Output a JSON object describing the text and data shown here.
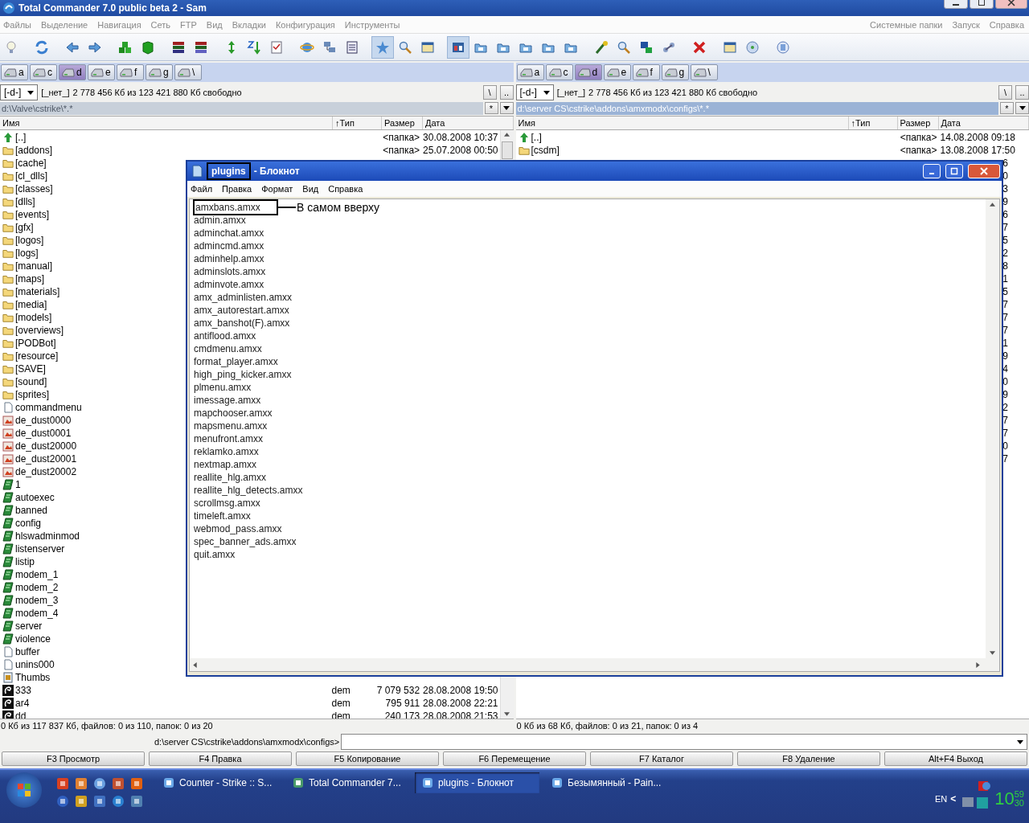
{
  "window": {
    "title": "Total Commander 7.0 public beta 2 - Sam"
  },
  "menu_left": [
    "Файлы",
    "Выделение",
    "Навигация",
    "Сеть",
    "FTP",
    "Вид",
    "Вкладки",
    "Конфигурация",
    "Инструменты"
  ],
  "menu_right": [
    "Системные папки",
    "Запуск",
    "Справка"
  ],
  "toolbar": [
    {
      "pressed": false
    },
    {
      "pressed": false
    },
    {
      "pressed": false
    },
    {
      "pressed": false
    },
    {
      "pressed": false
    },
    {
      "pressed": false
    },
    {
      "pressed": false
    },
    {
      "pressed": false
    },
    {
      "pressed": false
    },
    {
      "pressed": false
    },
    {
      "pressed": false
    },
    {
      "pressed": false
    },
    {
      "pressed": false
    },
    {
      "pressed": false
    },
    {
      "pressed": true
    },
    {
      "pressed": false
    },
    {
      "pressed": false
    },
    {
      "pressed": true
    },
    {
      "pressed": false
    },
    {
      "pressed": false
    },
    {
      "pressed": false
    },
    {
      "pressed": false
    },
    {
      "pressed": false
    },
    {
      "pressed": false
    },
    {
      "pressed": false
    },
    {
      "pressed": false
    },
    {
      "pressed": false
    },
    {
      "pressed": false
    },
    {
      "pressed": false
    },
    {
      "pressed": false
    },
    {
      "pressed": false
    }
  ],
  "panels": [
    {
      "drives": [
        {
          "label": "a",
          "selected": false
        },
        {
          "label": "c",
          "selected": false
        },
        {
          "label": "d",
          "selected": true
        },
        {
          "label": "e",
          "selected": false
        },
        {
          "label": "f",
          "selected": false
        },
        {
          "label": "g",
          "selected": false
        },
        {
          "label": "\\",
          "selected": false
        }
      ],
      "drive_select": "[-d-]",
      "volume": "[_нет_]",
      "free_space": "2 778 456 Кб из 123 421 880 Кб свободно",
      "root_button": "\\",
      "up_button": "..",
      "path": "d:\\Valve\\cstrike\\*.*",
      "active": false,
      "history_button": "*",
      "columns": [
        "Имя",
        "↑Тип",
        "Размер",
        "Дата"
      ],
      "scrollbar": true,
      "rows": [
        {
          "kind": "up",
          "name": "[..]",
          "type": "",
          "size": "<папка>",
          "date": "30.08.2008 10:37"
        },
        {
          "kind": "folder",
          "name": "[addons]",
          "size": "<папка>",
          "date": "25.07.2008 00:50"
        },
        {
          "kind": "folder",
          "name": "[cache]"
        },
        {
          "kind": "folder",
          "name": "[cl_dlls]"
        },
        {
          "kind": "folder",
          "name": "[classes]"
        },
        {
          "kind": "folder",
          "name": "[dlls]"
        },
        {
          "kind": "folder",
          "name": "[events]"
        },
        {
          "kind": "folder",
          "name": "[gfx]"
        },
        {
          "kind": "folder",
          "name": "[logos]"
        },
        {
          "kind": "folder",
          "name": "[logs]"
        },
        {
          "kind": "folder",
          "name": "[manual]"
        },
        {
          "kind": "folder",
          "name": "[maps]"
        },
        {
          "kind": "folder",
          "name": "[materials]"
        },
        {
          "kind": "folder",
          "name": "[media]"
        },
        {
          "kind": "folder",
          "name": "[models]"
        },
        {
          "kind": "folder",
          "name": "[overviews]"
        },
        {
          "kind": "folder",
          "name": "[PODBot]"
        },
        {
          "kind": "folder",
          "name": "[resource]"
        },
        {
          "kind": "folder",
          "name": "[SAVE]"
        },
        {
          "kind": "folder",
          "name": "[sound]"
        },
        {
          "kind": "folder",
          "name": "[sprites]"
        },
        {
          "kind": "doc",
          "name": "commandmenu"
        },
        {
          "kind": "image",
          "name": "de_dust0000"
        },
        {
          "kind": "image",
          "name": "de_dust0001"
        },
        {
          "kind": "image",
          "name": "de_dust20000"
        },
        {
          "kind": "image",
          "name": "de_dust20001"
        },
        {
          "kind": "image",
          "name": "de_dust20002"
        },
        {
          "kind": "cfg",
          "name": "1"
        },
        {
          "kind": "cfg",
          "name": "autoexec"
        },
        {
          "kind": "cfg",
          "name": "banned"
        },
        {
          "kind": "cfg",
          "name": "config"
        },
        {
          "kind": "cfg",
          "name": "hlswadminmod"
        },
        {
          "kind": "cfg",
          "name": "listenserver"
        },
        {
          "kind": "cfg",
          "name": "listip"
        },
        {
          "kind": "cfg",
          "name": "modem_1"
        },
        {
          "kind": "cfg",
          "name": "modem_2"
        },
        {
          "kind": "cfg",
          "name": "modem_3"
        },
        {
          "kind": "cfg",
          "name": "modem_4"
        },
        {
          "kind": "cfg",
          "name": "server"
        },
        {
          "kind": "cfg",
          "name": "violence"
        },
        {
          "kind": "doc",
          "name": "buffer"
        },
        {
          "kind": "doc",
          "name": "unins000"
        },
        {
          "kind": "thumbs",
          "name": "Thumbs"
        },
        {
          "kind": "demo",
          "name": "333",
          "type": "dem",
          "size": "7 079 532",
          "date": "28.08.2008 19:50"
        },
        {
          "kind": "demo",
          "name": "ar4",
          "type": "dem",
          "size": "795 911",
          "date": "28.08.2008 22:21"
        },
        {
          "kind": "demo",
          "name": "dd",
          "type": "dem",
          "size": "240 173",
          "date": "28.08.2008 21:53"
        }
      ],
      "status": "0 Кб из 117 837 Кб, файлов: 0 из 110, папок: 0 из 20"
    },
    {
      "drives": [
        {
          "label": "a",
          "selected": false
        },
        {
          "label": "c",
          "selected": false
        },
        {
          "label": "d",
          "selected": true
        },
        {
          "label": "e",
          "selected": false
        },
        {
          "label": "f",
          "selected": false
        },
        {
          "label": "g",
          "selected": false
        },
        {
          "label": "\\",
          "selected": false
        }
      ],
      "drive_select": "[-d-]",
      "volume": "[_нет_]",
      "free_space": "2 778 456 Кб из 123 421 880 Кб свободно",
      "root_button": "\\",
      "up_button": "..",
      "path": "d:\\server CS\\cstrike\\addons\\amxmodx\\configs\\*.*",
      "active": true,
      "history_button": "*",
      "columns": [
        "Имя",
        "↑Тип",
        "Размер",
        "Дата"
      ],
      "rows": [
        {
          "kind": "up",
          "name": "[..]",
          "size": "<папка>",
          "date": "14.08.2008 09:18"
        },
        {
          "kind": "folder",
          "name": "[csdm]",
          "size": "<папка>",
          "date": "13.08.2008 17:50"
        },
        {
          "kind": "hidden",
          "date": "6"
        },
        {
          "kind": "hidden",
          "date": "0"
        },
        {
          "kind": "hidden",
          "date": "3"
        },
        {
          "kind": "hidden",
          "date": "9"
        },
        {
          "kind": "hidden",
          "date": "6"
        },
        {
          "kind": "hidden",
          "date": "7"
        },
        {
          "kind": "hidden",
          "date": "5"
        },
        {
          "kind": "hidden",
          "date": "2"
        },
        {
          "kind": "hidden",
          "date": "8"
        },
        {
          "kind": "hidden",
          "date": "1"
        },
        {
          "kind": "hidden",
          "date": "5"
        },
        {
          "kind": "hidden",
          "date": "7"
        },
        {
          "kind": "hidden",
          "date": "7"
        },
        {
          "kind": "hidden",
          "date": "7"
        },
        {
          "kind": "hidden",
          "date": "1"
        },
        {
          "kind": "hidden",
          "date": "9"
        },
        {
          "kind": "hidden",
          "date": "4"
        },
        {
          "kind": "hidden",
          "date": "0"
        },
        {
          "kind": "hidden",
          "date": "9"
        },
        {
          "kind": "hidden",
          "date": "2"
        },
        {
          "kind": "hidden",
          "date": "7"
        },
        {
          "kind": "hidden",
          "date": "7"
        },
        {
          "kind": "hidden",
          "date": "0"
        },
        {
          "kind": "hidden",
          "date": "7"
        }
      ],
      "status": "0 Кб из 68 Кб, файлов: 0 из 21, папок: 0 из 4"
    }
  ],
  "command_line": {
    "prompt": "d:\\server CS\\cstrike\\addons\\amxmodx\\configs>"
  },
  "function_keys": [
    "F3 Просмотр",
    "F4 Правка",
    "F5 Копирование",
    "F6 Перемещение",
    "F7 Каталог",
    "F8 Удаление",
    "Alt+F4 Выход"
  ],
  "notepad": {
    "document": "plugins",
    "document_highlighted": true,
    "title_suffix": "- Блокнот",
    "menu": [
      "Файл",
      "Правка",
      "Формат",
      "Вид",
      "Справка"
    ],
    "lines": [
      {
        "text": "amxbans.amxx",
        "highlighted": true
      },
      {
        "text": "admin.amxx",
        "highlighted": false
      },
      {
        "text": "adminchat.amxx",
        "highlighted": false
      },
      {
        "text": "admincmd.amxx",
        "highlighted": false
      },
      {
        "text": "adminhelp.amxx",
        "highlighted": false
      },
      {
        "text": "adminslots.amxx",
        "highlighted": false
      },
      {
        "text": "adminvote.amxx",
        "highlighted": false
      },
      {
        "text": "amx_adminlisten.amxx",
        "highlighted": false
      },
      {
        "text": "amx_autorestart.amxx",
        "highlighted": false
      },
      {
        "text": "amx_banshot(F).amxx",
        "highlighted": false
      },
      {
        "text": "antiflood.amxx",
        "highlighted": false
      },
      {
        "text": "cmdmenu.amxx",
        "highlighted": false
      },
      {
        "text": "format_player.amxx",
        "highlighted": false
      },
      {
        "text": "high_ping_kicker.amxx",
        "highlighted": false
      },
      {
        "text": "plmenu.amxx",
        "highlighted": false
      },
      {
        "text": "imessage.amxx",
        "highlighted": false
      },
      {
        "text": "mapchooser.amxx",
        "highlighted": false
      },
      {
        "text": "mapsmenu.amxx",
        "highlighted": false
      },
      {
        "text": "menufront.amxx",
        "highlighted": false
      },
      {
        "text": "reklamko.amxx",
        "highlighted": false
      },
      {
        "text": "nextmap.amxx",
        "highlighted": false
      },
      {
        "text": "reallite_hlg.amxx",
        "highlighted": false
      },
      {
        "text": "reallite_hlg_detects.amxx",
        "highlighted": false
      },
      {
        "text": "scrollmsg.amxx",
        "highlighted": false
      },
      {
        "text": "timeleft.amxx",
        "highlighted": false
      },
      {
        "text": "webmod_pass.amxx",
        "highlighted": false
      },
      {
        "text": "spec_banner_ads.amxx",
        "highlighted": false
      },
      {
        "text": "quit.amxx",
        "highlighted": false
      }
    ],
    "annotation": "В самом вверху"
  },
  "taskbar": {
    "tasks": [
      {
        "label": "Counter - Strike :: S...",
        "selected": false
      },
      {
        "label": "Total Commander 7...",
        "selected": false
      },
      {
        "label": "plugins - Блокнот",
        "selected": true
      },
      {
        "label": "Безымянный - Pain...",
        "selected": false
      }
    ],
    "language": "EN",
    "tray_toggle": "<",
    "clock": {
      "hours": "10",
      "minutes": "59",
      "seconds": "30"
    }
  }
}
